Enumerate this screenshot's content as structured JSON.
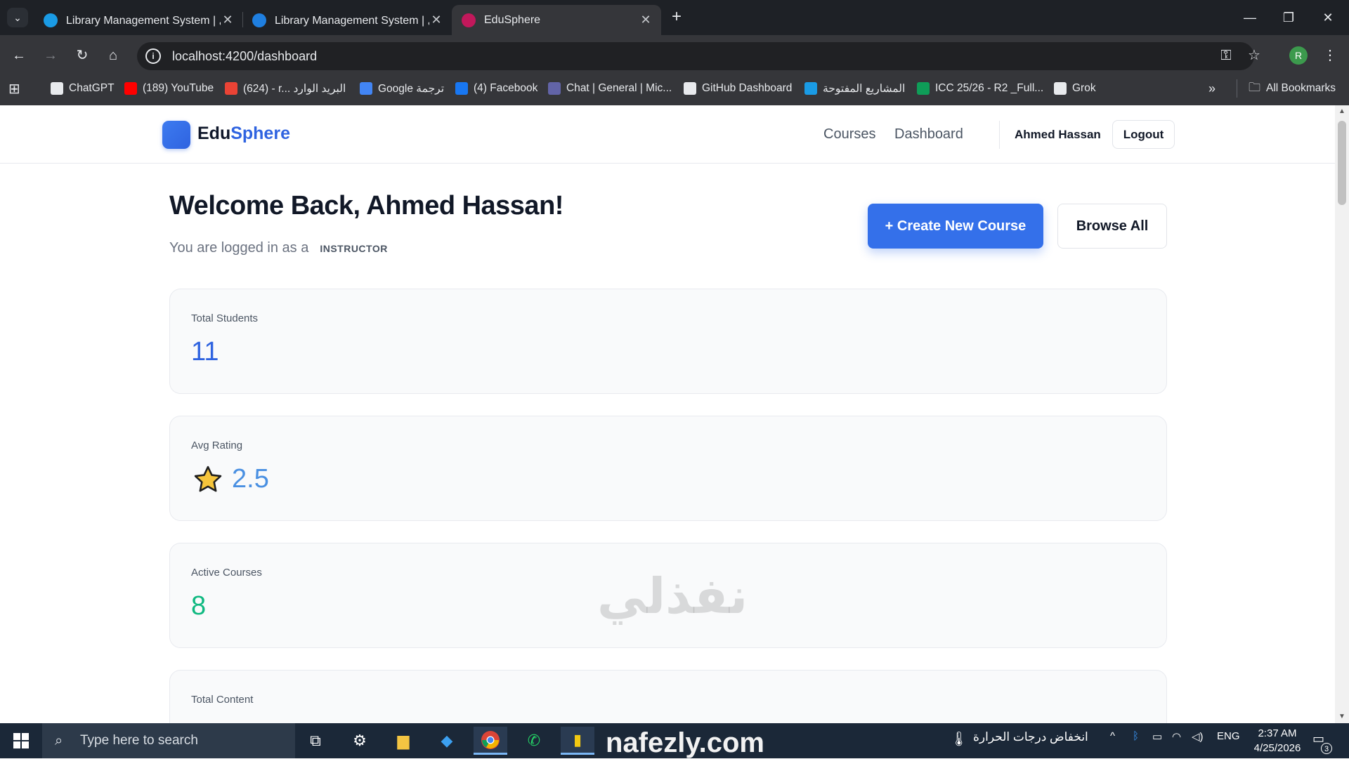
{
  "browser": {
    "tabs": [
      {
        "title": "Library Management System | ل",
        "active": false,
        "favicon_color": "#1a9be5"
      },
      {
        "title": "Library Management System | ل",
        "active": false,
        "favicon_color": "#1f7fe0"
      },
      {
        "title": "EduSphere",
        "active": true,
        "favicon_color": "#c2185b"
      }
    ],
    "url": "localhost:4200/dashboard",
    "profile_initial": "R",
    "bookmarks": [
      {
        "label": "ChatGPT",
        "icon": "chatgpt-icon",
        "color": "#e8eaed"
      },
      {
        "label": "(189) YouTube",
        "icon": "youtube-icon",
        "color": "#ff0000"
      },
      {
        "label": "(624) - r... البريد الوارد",
        "icon": "gmail-icon",
        "color": "#ea4335"
      },
      {
        "label": "Google ترجمة",
        "icon": "translate-icon",
        "color": "#4285f4"
      },
      {
        "label": "(4) Facebook",
        "icon": "facebook-icon",
        "color": "#1877f2"
      },
      {
        "label": "Chat | General | Mic...",
        "icon": "teams-icon",
        "color": "#6264a7"
      },
      {
        "label": "GitHub Dashboard",
        "icon": "github-icon",
        "color": "#e8eaed"
      },
      {
        "label": "المشاريع المفتوحة",
        "icon": "projects-icon",
        "color": "#1a9be5"
      },
      {
        "label": "ICC 25/26 - R2 _Full...",
        "icon": "sheets-icon",
        "color": "#0f9d58"
      },
      {
        "label": "Grok",
        "icon": "grok-icon",
        "color": "#e8eaed"
      }
    ],
    "all_bookmarks": "All Bookmarks"
  },
  "app": {
    "brand_part1": "Edu",
    "brand_part2": "Sphere",
    "nav": [
      "Courses",
      "Dashboard"
    ],
    "user_name": "Ahmed Hassan",
    "logout": "Logout",
    "welcome": "Welcome Back, Ahmed Hassan!",
    "role_prefix": "You are logged in as a",
    "role": "INSTRUCTOR",
    "create_button": "+ Create New Course",
    "browse_button": "Browse All",
    "stats": [
      {
        "label": "Total Students",
        "value": "11",
        "color": "#2f63e0"
      },
      {
        "label": "Avg Rating",
        "value": "2.5",
        "color": "#4a90e2",
        "icon": "star-icon"
      },
      {
        "label": "Active Courses",
        "value": "8",
        "color": "#10b981"
      },
      {
        "label": "Total Content",
        "value": "",
        "color": "#2f63e0"
      }
    ]
  },
  "watermark": {
    "arabic": "نفذلي",
    "text": "nafezly.com"
  },
  "taskbar": {
    "search_placeholder": "Type here to search",
    "weather": "انخفاض درجات الحرارة",
    "language": "ENG",
    "time": "2:37 AM",
    "date": "4/25/2026",
    "notifications": "3"
  }
}
